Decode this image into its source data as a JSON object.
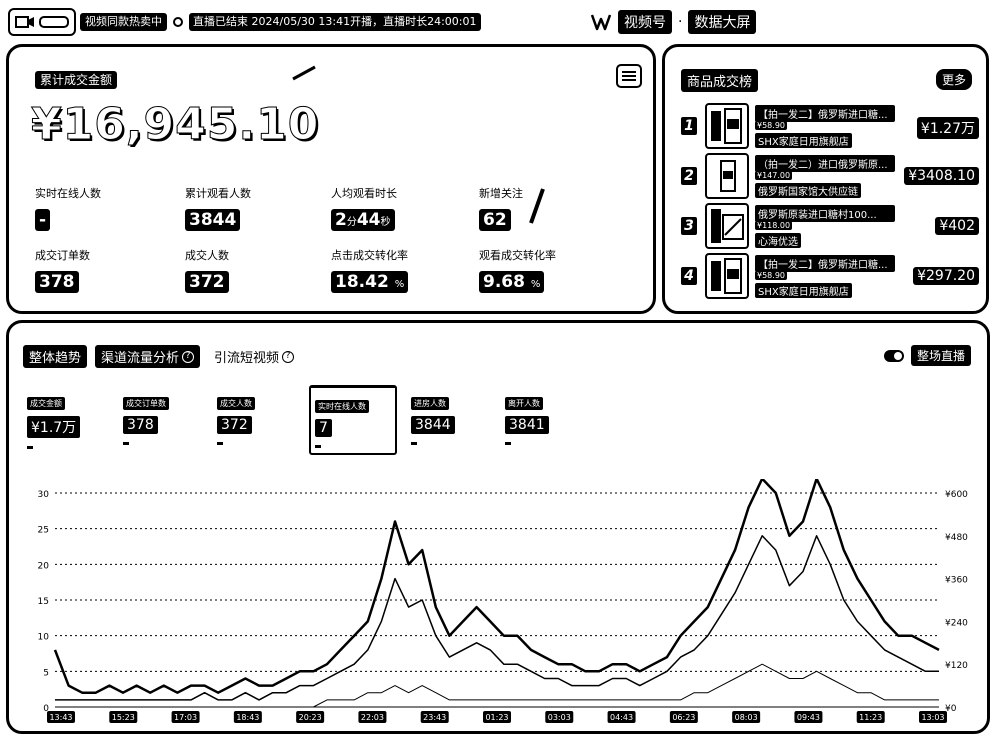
{
  "topbar": {
    "channel_status": "视频同款热卖中",
    "live_status": "直播已结束 2024/05/30 13:41开播，直播时长24:00:01",
    "app_name": "视频号",
    "dashboard_title": "数据大屏"
  },
  "summary": {
    "total_label": "累计成交金额",
    "total_value": "¥16,945.10",
    "metrics": [
      {
        "label": "实时在线人数",
        "value": "-",
        "unit": ""
      },
      {
        "label": "累计观看人数",
        "value": "3844",
        "unit": ""
      },
      {
        "label": "人均观看时长",
        "value": "2",
        "unit": "分",
        "value2": "44",
        "unit2": "秒"
      },
      {
        "label": "新增关注",
        "value": "62",
        "unit": ""
      },
      {
        "label": "成交订单数",
        "value": "378",
        "unit": ""
      },
      {
        "label": "成交人数",
        "value": "372",
        "unit": ""
      },
      {
        "label": "点击成交转化率",
        "value": "18.42",
        "unit": "%"
      },
      {
        "label": "观看成交转化率",
        "value": "9.68",
        "unit": "%"
      }
    ]
  },
  "ranking": {
    "title": "商品成交榜",
    "more": "更多",
    "items": [
      {
        "rank": "1",
        "name": "【拍一发二】俄罗斯进口糖...",
        "price": "¥58.90",
        "shop": "SHX家庭日用旗舰店",
        "amount": "¥1.27万"
      },
      {
        "rank": "2",
        "name": "（拍一发二）进口俄罗斯原...",
        "price": "¥147.00",
        "shop": "俄罗斯国家馆大供应链",
        "amount": "¥3408.10"
      },
      {
        "rank": "3",
        "name": "俄罗斯原装进口糖村100...",
        "price": "¥118.00",
        "shop": "心海优选",
        "amount": "¥402"
      },
      {
        "rank": "4",
        "name": "【拍一发二】俄罗斯进口糖...",
        "price": "¥58.90",
        "shop": "SHX家庭日用旗舰店",
        "amount": "¥297.20"
      }
    ]
  },
  "trend": {
    "tabs": [
      "整体趋势",
      "渠道流量分析",
      "引流短视频"
    ],
    "switch_label": "整场直播",
    "kpis": [
      {
        "label": "成交金额",
        "value": "¥1.7万"
      },
      {
        "label": "成交订单数",
        "value": "378"
      },
      {
        "label": "成交人数",
        "value": "372"
      },
      {
        "label": "实时在线人数",
        "value": "7"
      },
      {
        "label": "进房人数",
        "value": "3844"
      },
      {
        "label": "离开人数",
        "value": "3841"
      }
    ]
  },
  "chart_data": {
    "type": "line",
    "x_ticks": [
      "13:43",
      "15:23",
      "17:03",
      "18:43",
      "20:23",
      "22:03",
      "23:43",
      "01:23",
      "03:03",
      "04:43",
      "06:23",
      "08:03",
      "09:43",
      "11:23",
      "13:03"
    ],
    "y_left_ticks": [
      "0",
      "5",
      "10",
      "15",
      "20",
      "25",
      "30"
    ],
    "y_right_ticks": [
      "¥0",
      "¥120",
      "¥240",
      "¥360",
      "¥480",
      "¥600"
    ],
    "ylim_left": [
      0,
      30
    ],
    "ylim_right": [
      0,
      600
    ],
    "series": [
      {
        "values": [
          8,
          3,
          2,
          2,
          3,
          2,
          3,
          2,
          3,
          2,
          3,
          3,
          2,
          3,
          4,
          3,
          3,
          4,
          5,
          5,
          6,
          8,
          10,
          12,
          18,
          26,
          20,
          22,
          14,
          10,
          12,
          14,
          12,
          10,
          10,
          8,
          7,
          6,
          6,
          5,
          5,
          6,
          6,
          5,
          6,
          7,
          10,
          12,
          14,
          18,
          22,
          28,
          32,
          30,
          24,
          26,
          32,
          28,
          22,
          18,
          15,
          12,
          10,
          10,
          9,
          8
        ]
      },
      {
        "values": [
          1,
          1,
          1,
          1,
          1,
          1,
          1,
          1,
          1,
          1,
          1,
          2,
          1,
          1,
          2,
          1,
          2,
          2,
          3,
          3,
          4,
          5,
          6,
          8,
          12,
          18,
          14,
          15,
          10,
          7,
          8,
          9,
          8,
          6,
          6,
          5,
          4,
          4,
          3,
          3,
          3,
          4,
          4,
          3,
          4,
          5,
          7,
          8,
          10,
          13,
          16,
          20,
          24,
          22,
          17,
          19,
          24,
          20,
          15,
          12,
          10,
          8,
          7,
          6,
          5,
          5
        ]
      },
      {
        "values": [
          0,
          0,
          0,
          0,
          0,
          0,
          0,
          0,
          0,
          0,
          0,
          0,
          0,
          0,
          0,
          0,
          0,
          0,
          0,
          0,
          1,
          1,
          1,
          2,
          2,
          3,
          2,
          3,
          2,
          1,
          1,
          1,
          1,
          1,
          1,
          1,
          1,
          1,
          1,
          1,
          1,
          1,
          1,
          1,
          1,
          1,
          1,
          2,
          2,
          3,
          4,
          5,
          6,
          5,
          4,
          4,
          5,
          4,
          3,
          2,
          2,
          1,
          1,
          1,
          1,
          1
        ]
      }
    ]
  }
}
